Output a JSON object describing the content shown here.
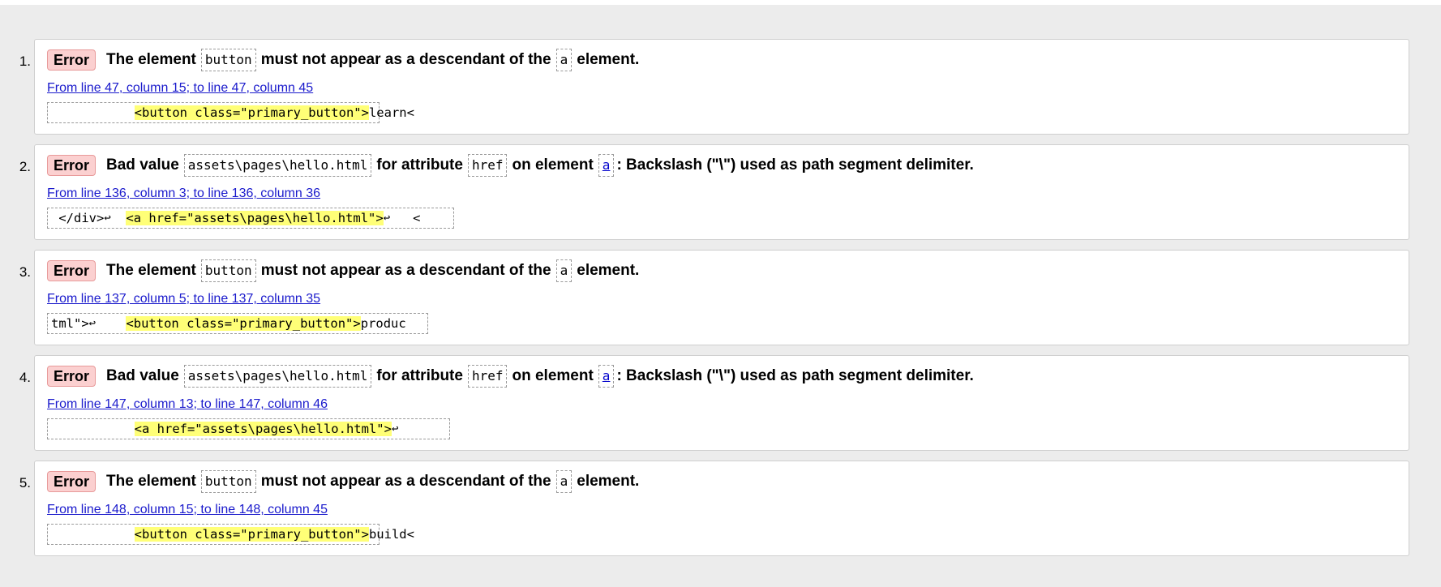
{
  "badge_label": "Error",
  "line_break_glyph": "↩",
  "messages": [
    {
      "number": "1.",
      "parts": [
        "The element",
        "button",
        "must not appear as a descendant of the",
        "a",
        "element."
      ],
      "location": "From line 47, column 15; to line 47, column 45",
      "extract": {
        "pre": "           ",
        "hl": "<button class=\"primary_button\">",
        "post": "learn<"
      }
    },
    {
      "number": "2.",
      "parts": [
        "Bad value",
        "assets\\pages\\hello.html",
        "for attribute",
        "href",
        "on element",
        "a",
        ": Backslash (\"\\\") used as path segment delimiter."
      ],
      "location": "From line 136, column 3; to line 136, column 36",
      "extract": {
        "pre": " </div>",
        "hl": "<a href=\"assets\\pages\\hello.html\">",
        "post": "   <"
      }
    },
    {
      "number": "3.",
      "parts": [
        "The element",
        "button",
        "must not appear as a descendant of the",
        "a",
        "element."
      ],
      "location": "From line 137, column 5; to line 137, column 35",
      "extract": {
        "pre": "tml\">",
        "hl": "<button class=\"primary_button\">",
        "post": "produc"
      }
    },
    {
      "number": "4.",
      "parts": [
        "Bad value",
        "assets\\pages\\hello.html",
        "for attribute",
        "href",
        "on element",
        "a",
        ": Backslash (\"\\\") used as path segment delimiter."
      ],
      "location": "From line 147, column 13; to line 147, column 46",
      "extract": {
        "pre": "           ",
        "hl": "<a href=\"assets\\pages\\hello.html\">",
        "post": ""
      }
    },
    {
      "number": "5.",
      "parts": [
        "The element",
        "button",
        "must not appear as a descendant of the",
        "a",
        "element."
      ],
      "location": "From line 148, column 15; to line 148, column 45",
      "extract": {
        "pre": "           ",
        "hl": "<button class=\"primary_button\">",
        "post": "build<"
      }
    }
  ]
}
